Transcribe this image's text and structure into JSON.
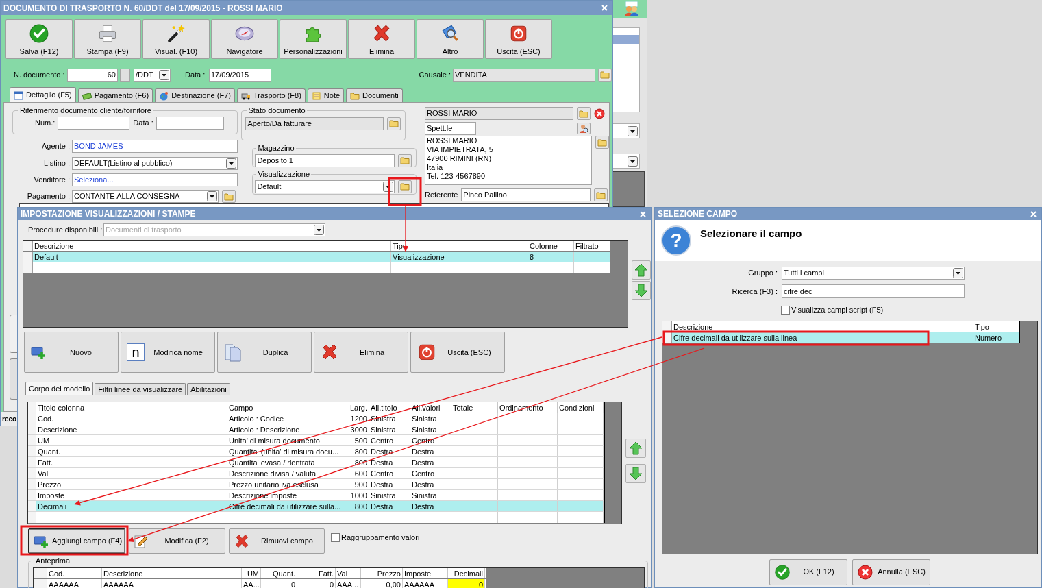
{
  "main_window": {
    "title": "DOCUMENTO DI TRASPORTO N. 60/DDT del 17/09/2015 - ROSSI MARIO",
    "toolbar": [
      {
        "label": "Salva (F12)"
      },
      {
        "label": "Stampa (F9)"
      },
      {
        "label": "Visual. (F10)"
      },
      {
        "label": "Navigatore"
      },
      {
        "label": "Personalizzazioni"
      },
      {
        "label": "Elimina"
      },
      {
        "label": "Altro"
      },
      {
        "label": "Uscita (ESC)"
      }
    ],
    "doc_number": {
      "label": "N. documento :",
      "value": "60",
      "series": "/DDT"
    },
    "date": {
      "label": "Data :",
      "value": "17/09/2015"
    },
    "causale": {
      "label": "Causale :",
      "value": "VENDITA"
    },
    "tabs": [
      {
        "label": "Dettaglio (F5)",
        "selected": true
      },
      {
        "label": "Pagamento (F6)",
        "selected": false
      },
      {
        "label": "Destinazione (F7)",
        "selected": false
      },
      {
        "label": "Trasporto (F8)",
        "selected": false
      },
      {
        "label": "Note",
        "selected": false
      },
      {
        "label": "Documenti",
        "selected": false
      }
    ],
    "riferimento": {
      "title": "Riferimento documento cliente/fornitore",
      "num_label": "Num.:",
      "data_label": "Data :"
    },
    "agente": {
      "label": "Agente :",
      "value": "BOND JAMES"
    },
    "listino": {
      "label": "Listino :",
      "value": "DEFAULT(Listino al pubblico)"
    },
    "venditore": {
      "label": "Venditore :",
      "value": "Seleziona..."
    },
    "pagamento": {
      "label": "Pagamento :",
      "value": "CONTANTE ALLA CONSEGNA"
    },
    "stato": {
      "title": "Stato documento",
      "value": "Aperto/Da fatturare"
    },
    "magazzino": {
      "title": "Magazzino",
      "value": "Deposito 1"
    },
    "visualizzazione": {
      "title": "Visualizzazione",
      "value": "Default"
    },
    "cliente": {
      "name": "ROSSI MARIO",
      "salutation": "Spett.le",
      "address": [
        "ROSSI MARIO",
        "VIA IMPIETRATA, 5",
        "47900 RIMINI (RN)",
        "Italia",
        "Tel. 123-4567890"
      ],
      "referente_label": "Referente",
      "referente": "Pinco Pallino"
    },
    "status_text": "reco"
  },
  "settings_dialog": {
    "title": "IMPOSTAZIONE VISUALIZZAZIONI / STAMPE",
    "procedure": {
      "label": "Procedure disponibili :",
      "value": "Documenti di trasporto",
      "disabled": true
    },
    "models": {
      "columns": [
        {
          "label": "Descrizione",
          "kind": "text"
        },
        {
          "label": "Tipo",
          "kind": "text"
        },
        {
          "label": "Colonne",
          "kind": "text"
        },
        {
          "label": "Filtrato",
          "kind": "text"
        }
      ],
      "rows": [
        {
          "cells": [
            "Default",
            "Visualizzazione",
            "8",
            ""
          ],
          "selected": true
        }
      ]
    },
    "buttons": [
      {
        "label": "Nuovo"
      },
      {
        "label": "Modifica nome",
        "badge": "n"
      },
      {
        "label": "Duplica"
      },
      {
        "label": "Elimina"
      },
      {
        "label": "Uscita (ESC)"
      }
    ],
    "tabs": [
      {
        "label": "Corpo del modello",
        "selected": true
      },
      {
        "label": "Filtri linee da visualizzare",
        "selected": false
      },
      {
        "label": "Abilitazioni",
        "selected": false
      }
    ],
    "fields_table": {
      "columns": [
        {
          "label": "Titolo colonna",
          "kind": "text"
        },
        {
          "label": "Campo",
          "kind": "text"
        },
        {
          "label": "Larg.",
          "kind": "number"
        },
        {
          "label": "All.titolo",
          "kind": "text"
        },
        {
          "label": "All.valori",
          "kind": "text"
        },
        {
          "label": "Totale",
          "kind": "text"
        },
        {
          "label": "Ordinamento",
          "kind": "text"
        },
        {
          "label": "Condizioni",
          "kind": "text"
        }
      ],
      "rows": [
        {
          "cells": [
            "Cod.",
            "Articolo : Codice",
            "1200",
            "Sinistra",
            "Sinistra"
          ],
          "selected": false
        },
        {
          "cells": [
            "Descrizione",
            "Articolo : Descrizione",
            "3000",
            "Sinistra",
            "Sinistra"
          ],
          "selected": false
        },
        {
          "cells": [
            "UM",
            "Unita' di misura documento",
            "500",
            "Centro",
            "Centro"
          ],
          "selected": false
        },
        {
          "cells": [
            "Quant.",
            "Quantita' (unita' di misura docu...",
            "800",
            "Destra",
            "Destra"
          ],
          "selected": false
        },
        {
          "cells": [
            "Fatt.",
            "Quantita' evasa / rientrata",
            "800",
            "Destra",
            "Destra"
          ],
          "selected": false
        },
        {
          "cells": [
            "Val",
            "Descrizione divisa / valuta",
            "600",
            "Centro",
            "Centro"
          ],
          "selected": false
        },
        {
          "cells": [
            "Prezzo",
            "Prezzo unitario iva esclusa",
            "900",
            "Destra",
            "Destra"
          ],
          "selected": false
        },
        {
          "cells": [
            "Imposte",
            "Descrizione imposte",
            "1000",
            "Sinistra",
            "Sinistra"
          ],
          "selected": false
        },
        {
          "cells": [
            "Decimali",
            "Cifre decimali da utilizzare sulla...",
            "800",
            "Destra",
            "Destra"
          ],
          "selected": true
        }
      ]
    },
    "field_buttons": [
      {
        "label": "Aggiungi campo (F4)",
        "highlighted": true
      },
      {
        "label": "Modifica (F2)",
        "highlighted": false
      },
      {
        "label": "Rimuovi campo",
        "highlighted": false
      }
    ],
    "grouping": {
      "label": "Raggruppamento valori",
      "checked": false
    },
    "preview": {
      "title": "Anteprima",
      "columns": [
        {
          "label": "Cod.",
          "kind": "text"
        },
        {
          "label": "Descrizione",
          "kind": "text"
        },
        {
          "label": "UM",
          "kind": "number"
        },
        {
          "label": "Quant.",
          "kind": "number"
        },
        {
          "label": "Fatt.",
          "kind": "number"
        },
        {
          "label": "Val",
          "kind": "text"
        },
        {
          "label": "Prezzo",
          "kind": "number"
        },
        {
          "label": "Imposte",
          "kind": "text"
        },
        {
          "label": "Decimali",
          "kind": "number"
        }
      ],
      "cells": [
        {
          "text": "AAAAAA",
          "highlighted": false
        },
        {
          "text": "AAAAAA",
          "highlighted": false
        },
        {
          "text": "AA...",
          "highlighted": false
        },
        {
          "text": "0",
          "highlighted": false
        },
        {
          "text": "0",
          "highlighted": false
        },
        {
          "text": "AAA...",
          "highlighted": false
        },
        {
          "text": "0,00",
          "highlighted": false
        },
        {
          "text": "AAAAAA",
          "highlighted": false
        },
        {
          "text": "0",
          "highlighted": true
        }
      ]
    }
  },
  "field_dialog": {
    "title": "SELEZIONE CAMPO",
    "glyph": "?",
    "heading": "Selezionare il campo",
    "gruppo": {
      "label": "Gruppo :",
      "value": "Tutti i campi"
    },
    "ricerca": {
      "label": "Ricerca (F3) :",
      "value": "cifre dec"
    },
    "script_fields": {
      "label": "Visualizza campi script (F5)",
      "checked": false
    },
    "results": {
      "columns": [
        {
          "label": "Descrizione",
          "kind": "text"
        },
        {
          "label": "Tipo",
          "kind": "text"
        }
      ],
      "rows": [
        {
          "cells": [
            "Cifre decimali da utilizzare sulla linea",
            "Numero"
          ],
          "selected": true
        }
      ]
    },
    "buttons": [
      {
        "label": "OK (F12)"
      },
      {
        "label": "Annulla (ESC)"
      }
    ]
  }
}
